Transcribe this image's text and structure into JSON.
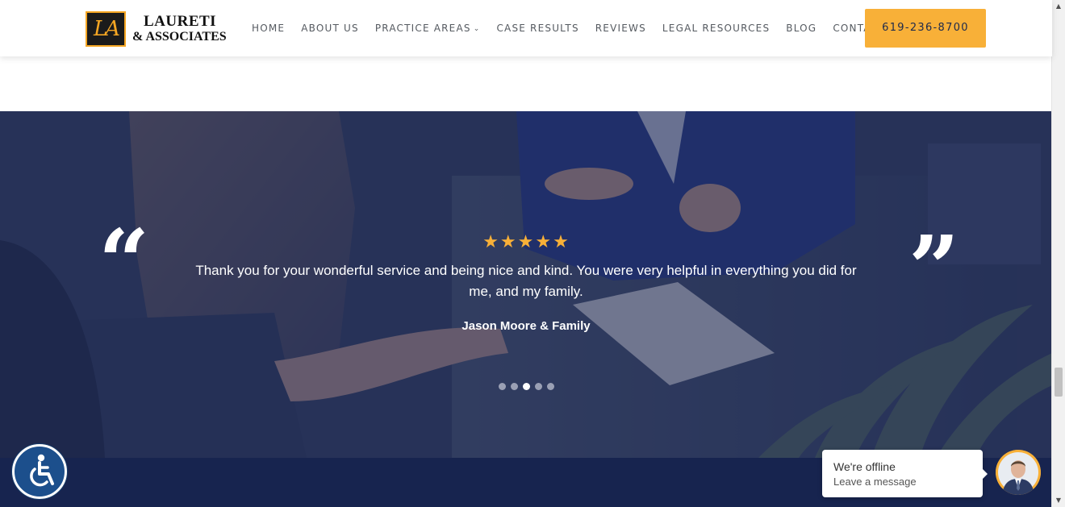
{
  "header": {
    "logo": {
      "mark": "LA",
      "line1": "LAURETI",
      "line2": "& ASSOCIATES"
    },
    "nav": [
      {
        "label": "HOME",
        "name": "nav-home"
      },
      {
        "label": "ABOUT US",
        "name": "nav-about-us"
      },
      {
        "label": "PRACTICE AREAS",
        "name": "nav-practice-areas",
        "dropdown": true
      },
      {
        "label": "CASE RESULTS",
        "name": "nav-case-results"
      },
      {
        "label": "REVIEWS",
        "name": "nav-reviews"
      },
      {
        "label": "LEGAL RESOURCES",
        "name": "nav-legal-resources"
      },
      {
        "label": "BLOG",
        "name": "nav-blog"
      },
      {
        "label": "CONTACT",
        "name": "nav-contact"
      }
    ],
    "phone": "619-236-8700"
  },
  "testimonial": {
    "open_quote": "“",
    "close_quote": "”",
    "stars": "★★★★★",
    "rating": 5,
    "text": "Thank you for your wonderful service and being nice and kind. You were very helpful in everything you did for me, and my family.",
    "author": "Jason Moore & Family",
    "slide_count": 5,
    "active_slide": 3
  },
  "chat": {
    "title": "We're offline",
    "subtitle": "Leave a message"
  },
  "colors": {
    "accent": "#f8b038",
    "navy": "#17244f",
    "overlay": "#182452"
  },
  "icons": {
    "accessibility": "accessibility-icon",
    "chevron": "chevron-down-icon",
    "avatar": "agent-avatar"
  }
}
